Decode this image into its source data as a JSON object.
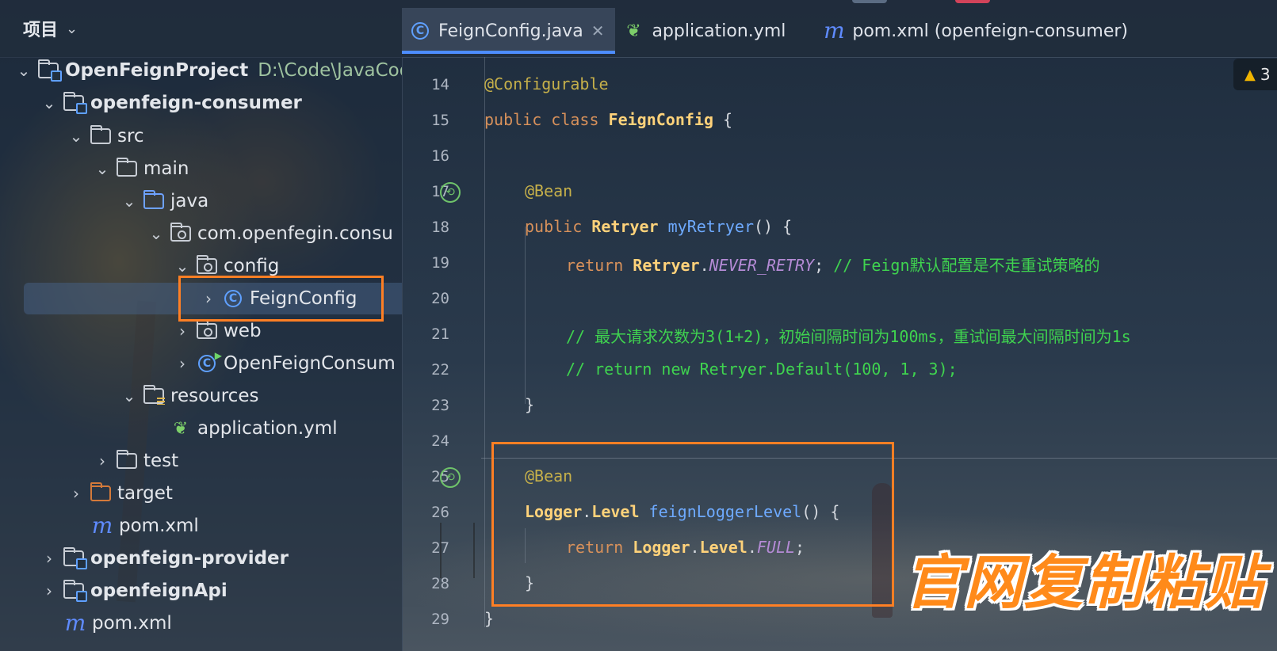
{
  "header": {
    "project_label": "项目",
    "tabs": [
      {
        "label": "FeignConfig.java",
        "icon": "class-icon",
        "active": true
      },
      {
        "label": "application.yml",
        "icon": "spring-yml-icon",
        "active": false
      },
      {
        "label": "pom.xml (openfeign-consumer)",
        "icon": "maven-icon",
        "active": false
      }
    ],
    "warning_count": "3"
  },
  "tree": {
    "root_name": "OpenFeignProject",
    "root_path": "D:\\Code\\JavaCod",
    "items": [
      {
        "label": "openfeign-consumer"
      },
      {
        "label": "src"
      },
      {
        "label": "main"
      },
      {
        "label": "java"
      },
      {
        "label": "com.openfegin.consu"
      },
      {
        "label": "config"
      },
      {
        "label": "FeignConfig"
      },
      {
        "label": "web"
      },
      {
        "label": "OpenFeignConsum"
      },
      {
        "label": "resources"
      },
      {
        "label": "application.yml"
      },
      {
        "label": "test"
      },
      {
        "label": "target"
      },
      {
        "label": "pom.xml"
      },
      {
        "label": "openfeign-provider"
      },
      {
        "label": "openfeignApi"
      },
      {
        "label": "pom.xml"
      }
    ]
  },
  "editor": {
    "line_numbers": [
      "14",
      "15",
      "16",
      "17",
      "18",
      "19",
      "20",
      "21",
      "22",
      "23",
      "24",
      "25",
      "26",
      "27",
      "28",
      "29"
    ],
    "code": {
      "l14_ann": "@Configurable",
      "l15_kw": "public class ",
      "l15_cls": "FeignConfig",
      "l15_brace": " {",
      "l17_ann": "@Bean",
      "l18_kw": "public ",
      "l18_cls": "Retryer",
      "l18_fn": " myRetryer",
      "l18_rest": "() {",
      "l19_kw": "return ",
      "l19_cls": "Retryer",
      "l19_dot": ".",
      "l19_const": "NEVER_RETRY",
      "l19_semi": "; ",
      "l19_comment": "// Feign默认配置是不走重试策略的",
      "l21_comment": "// 最大请求次数为3(1+2)，初始间隔时间为100ms，重试间最大间隔时间为1s",
      "l22_comment": "// return new Retryer.Default(100, 1, 3);",
      "l23_brace": "}",
      "l25_ann": "@Bean",
      "l26_cls1": "Logger",
      "l26_dot": ".",
      "l26_cls2": "Level",
      "l26_fn": " feignLoggerLevel",
      "l26_rest": "() {",
      "l27_kw": "return ",
      "l27_cls1": "Logger",
      "l27_dot1": ".",
      "l27_cls2": "Level",
      "l27_dot2": ".",
      "l27_const": "FULL",
      "l27_semi": ";",
      "l28_brace": "}",
      "l29_brace": "}"
    }
  },
  "overlay_caption": "官网复制粘贴"
}
